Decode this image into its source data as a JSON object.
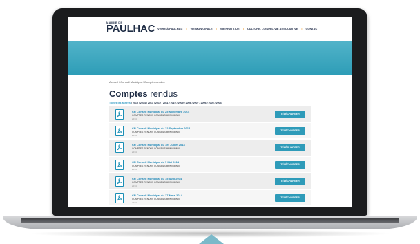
{
  "site": {
    "logo_small": "MAIRIE DE",
    "logo_big": "PAULHAC",
    "nav": [
      "VIVRE À PAULHAC",
      "VIE MUNICIPALE",
      "VIE PRATIQUE",
      "CULTURE, LOISIRS, VIE ASSOCIATIVE",
      "CONTACT"
    ]
  },
  "breadcrumb": "Accueil / Conseil Municipal / Comptes-rendus",
  "page_title": {
    "bold": "Comptes",
    "rest": " rendus"
  },
  "years": {
    "label": "Toutes les années",
    "list": "/ 2015 / 2014 / 2013 / 2012 / 2011 / 2010 / 2009 / 2008 / 2007 / 2006 / 2005 / 2004"
  },
  "documents": [
    {
      "title": "CR Conseil Municipal du 25 Novembre 2014",
      "subtitle": "COMPTES RENDUS CONSEILS MUNICIPAUX",
      "year": "2014",
      "button": "TÉLÉCHARGER"
    },
    {
      "title": "CR Conseil Municipal du 12 Septembre 2014",
      "subtitle": "COMPTES RENDUS CONSEILS MUNICIPAUX",
      "year": "2014",
      "button": "TÉLÉCHARGER"
    },
    {
      "title": "CR Conseil Municipal du 1er Juillet 2014",
      "subtitle": "COMPTES RENDUS CONSEILS MUNICIPAUX",
      "year": "2014",
      "button": "TÉLÉCHARGER"
    },
    {
      "title": "CR Conseil Municipal du 7 Mai 2014",
      "subtitle": "COMPTES RENDUS CONSEILS MUNICIPAUX",
      "year": "2014",
      "button": "TÉLÉCHARGER"
    },
    {
      "title": "CR Conseil Municipal du 15 Avril 2014",
      "subtitle": "COMPTES RENDUS CONSEILS MUNICIPAUX",
      "year": "2014",
      "button": "TÉLÉCHARGER"
    },
    {
      "title": "CR Conseil Municipal du 27 Mars 2014",
      "subtitle": "COMPTES RENDUS CONSEILS MUNICIPAUX",
      "year": "2014",
      "button": "TÉLÉCHARGER"
    }
  ],
  "colors": {
    "accent": "#2e9bb9",
    "brand": "#1f2d45",
    "nav_separator": "#f0a13a"
  },
  "icons": {
    "document": "pdf-icon"
  }
}
